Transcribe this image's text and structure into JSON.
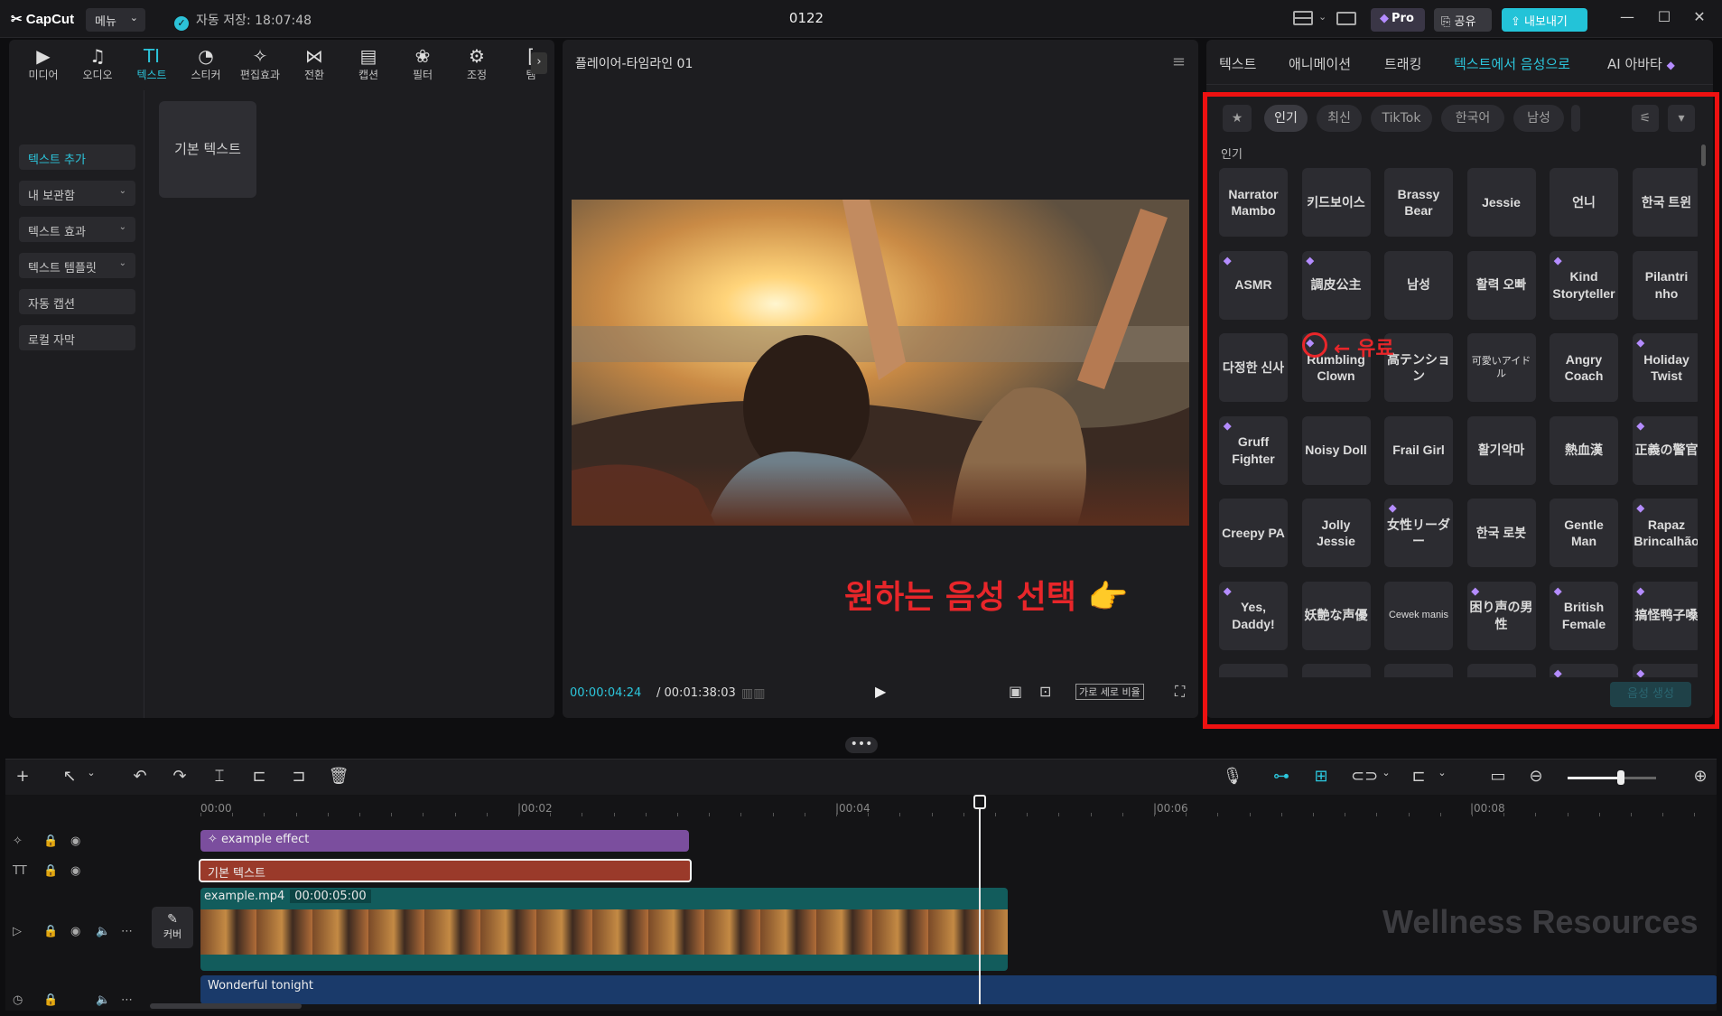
{
  "titlebar": {
    "app_name": "CapCut",
    "menu_label": "메뉴",
    "autosave": "자동 저장: 18:07:48",
    "project_name": "0122",
    "pro_label": "Pro",
    "share_label": "공유",
    "export_label": "내보내기"
  },
  "tool_tabs": [
    {
      "label": "미디어",
      "icon": "▶"
    },
    {
      "label": "오디오",
      "icon": "♫"
    },
    {
      "label": "텍스트",
      "icon": "TI"
    },
    {
      "label": "스티커",
      "icon": "◔"
    },
    {
      "label": "편집효과",
      "icon": "✧"
    },
    {
      "label": "전환",
      "icon": "⋈"
    },
    {
      "label": "캡션",
      "icon": "▤"
    },
    {
      "label": "필터",
      "icon": "❀"
    },
    {
      "label": "조정",
      "icon": "⚙"
    },
    {
      "label": "템",
      "icon": "["
    }
  ],
  "left_menu": {
    "items": [
      "텍스트 추가",
      "내 보관함",
      "텍스트 효과",
      "텍스트 템플릿",
      "자동 캡션",
      "로컬 자막"
    ],
    "basic_text_tile": "기본 텍스트"
  },
  "player": {
    "title": "플레이어-타임라인 01",
    "current_time": "00:00:04:24",
    "total_time": "00:01:38:03",
    "ratio_label": "가로 세로 비율"
  },
  "annotations": {
    "main": "원하는 음성 선택 👉",
    "paid": "← 유료"
  },
  "right_panel": {
    "tabs": [
      "텍스트",
      "애니메이션",
      "트래킹",
      "텍스트에서 음성으로",
      "AI 아바타"
    ],
    "chips": [
      "인기",
      "최신",
      "TikTok",
      "한국어",
      "남성"
    ],
    "section_label": "인기",
    "generate_label": "음성 생성",
    "voices": [
      {
        "name": "Narrator Mambo",
        "pro": false
      },
      {
        "name": "키드보이스",
        "pro": false
      },
      {
        "name": "Brassy Bear",
        "pro": false
      },
      {
        "name": "Jessie",
        "pro": false
      },
      {
        "name": "언니",
        "pro": false
      },
      {
        "name": "한국 트윈",
        "pro": false
      },
      {
        "name": "ASMR",
        "pro": true
      },
      {
        "name": "調皮公主",
        "pro": true
      },
      {
        "name": "남성",
        "pro": false
      },
      {
        "name": "활력 오빠",
        "pro": false
      },
      {
        "name": "Kind Storyteller",
        "pro": true
      },
      {
        "name": "Pilantri nho",
        "pro": false
      },
      {
        "name": "다정한 신사",
        "pro": false
      },
      {
        "name": "Rumbling Clown",
        "pro": true
      },
      {
        "name": "高テンション",
        "pro": false
      },
      {
        "name": "可愛いアイドル",
        "pro": false,
        "small": true
      },
      {
        "name": "Angry Coach",
        "pro": false
      },
      {
        "name": "Holiday Twist",
        "pro": true
      },
      {
        "name": "Gruff Fighter",
        "pro": true
      },
      {
        "name": "Noisy Doll",
        "pro": false
      },
      {
        "name": "Frail Girl",
        "pro": false
      },
      {
        "name": "활기악마",
        "pro": false
      },
      {
        "name": "熱血漢",
        "pro": false
      },
      {
        "name": "正義の警官",
        "pro": true
      },
      {
        "name": "Creepy PA",
        "pro": false
      },
      {
        "name": "Jolly Jessie",
        "pro": false
      },
      {
        "name": "女性リーダー",
        "pro": true
      },
      {
        "name": "한국 로봇",
        "pro": false
      },
      {
        "name": "Gentle Man",
        "pro": false
      },
      {
        "name": "Rapaz Brincalhão",
        "pro": true
      },
      {
        "name": "Yes, Daddy!",
        "pro": true
      },
      {
        "name": "妖艶な声優",
        "pro": false
      },
      {
        "name": "Cewek manis",
        "pro": false,
        "small": true
      },
      {
        "name": "困り声の男性",
        "pro": true
      },
      {
        "name": "British Female",
        "pro": true
      },
      {
        "name": "搞怪鸭子嗓",
        "pro": true
      },
      {
        "name": "",
        "pro": false
      },
      {
        "name": "",
        "pro": false
      },
      {
        "name": "",
        "pro": false
      },
      {
        "name": "",
        "pro": false
      },
      {
        "name": "",
        "pro": true
      },
      {
        "name": "",
        "pro": true
      }
    ]
  },
  "timeline": {
    "ruler_labels": [
      "00:00",
      "|00:02",
      "|00:04",
      "|00:06",
      "|00:08"
    ],
    "effect_clip": "example effect",
    "text_clip": "기본 텍스트",
    "video_clip_name": "example.mp4",
    "video_clip_duration": "00:00:05:00",
    "cover_label": "커버",
    "audio_clip": "Wonderful tonight",
    "zoom_level": 0.6
  },
  "watermark": "Wellness Resources"
}
